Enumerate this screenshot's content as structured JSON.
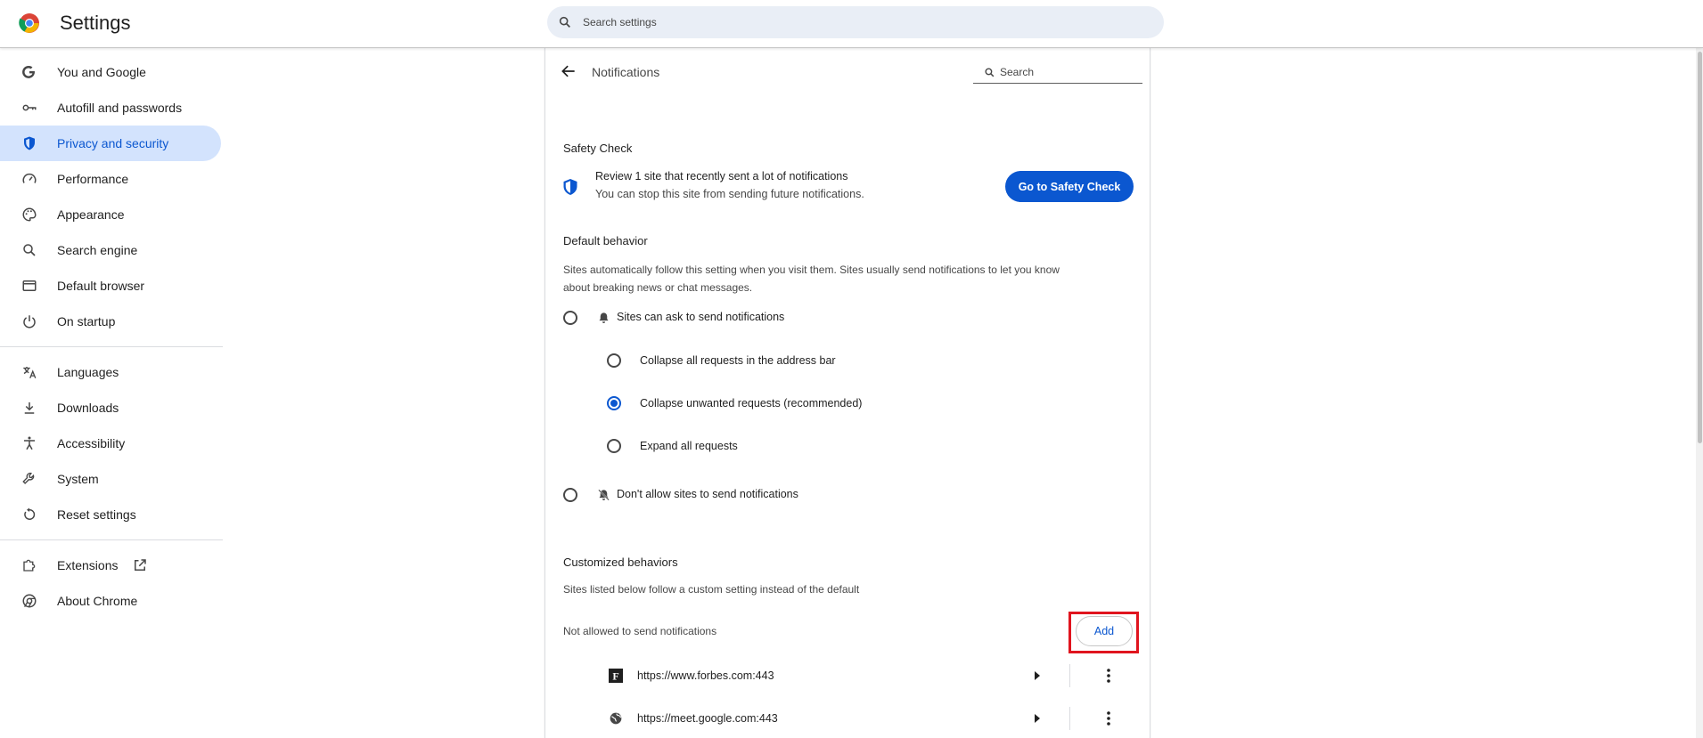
{
  "app": {
    "title": "Settings",
    "search_placeholder": "Search settings"
  },
  "colors": {
    "accent": "#0b57d0",
    "active_nav_bg": "#d3e3fd",
    "search_bg": "#e9eef6",
    "highlight": "#e0141e"
  },
  "sidebar": {
    "items": [
      {
        "label": "You and Google",
        "icon": "google-g-icon"
      },
      {
        "label": "Autofill and passwords",
        "icon": "key-icon"
      },
      {
        "label": "Privacy and security",
        "icon": "shield-icon",
        "active": true
      },
      {
        "label": "Performance",
        "icon": "speedometer-icon"
      },
      {
        "label": "Appearance",
        "icon": "palette-icon"
      },
      {
        "label": "Search engine",
        "icon": "search-icon"
      },
      {
        "label": "Default browser",
        "icon": "browser-window-icon"
      },
      {
        "label": "On startup",
        "icon": "power-icon"
      },
      {
        "label": "Languages",
        "icon": "translate-icon"
      },
      {
        "label": "Downloads",
        "icon": "download-icon"
      },
      {
        "label": "Accessibility",
        "icon": "accessibility-icon"
      },
      {
        "label": "System",
        "icon": "wrench-icon"
      },
      {
        "label": "Reset settings",
        "icon": "reset-icon"
      },
      {
        "label": "Extensions",
        "icon": "puzzle-icon"
      },
      {
        "label": "About Chrome",
        "icon": "chrome-icon"
      }
    ]
  },
  "page": {
    "title": "Notifications",
    "search_placeholder": "Search",
    "safety_check": {
      "heading": "Safety Check",
      "title": "Review 1 site that recently sent a lot of notifications",
      "subtitle": "You can stop this site from sending future notifications.",
      "button": "Go to Safety Check"
    },
    "default_behavior": {
      "heading": "Default behavior",
      "description_line1": "Sites automatically follow this setting when you visit them. Sites usually send notifications to let you know",
      "description_line2": "about breaking news or chat messages.",
      "option_ask": "Sites can ask to send notifications",
      "sub_options": [
        {
          "label": "Collapse all requests in the address bar",
          "checked": false
        },
        {
          "label": "Collapse unwanted requests (recommended)",
          "checked": true
        },
        {
          "label": "Expand all requests",
          "checked": false
        }
      ],
      "option_block": "Don't allow sites to send notifications"
    },
    "customized": {
      "heading": "Customized behaviors",
      "description": "Sites listed below follow a custom setting instead of the default",
      "not_allowed_label": "Not allowed to send notifications",
      "add_button": "Add",
      "sites": [
        {
          "url": "https://www.forbes.com:443",
          "icon": "forbes-favicon"
        },
        {
          "url": "https://meet.google.com:443",
          "icon": "globe-icon"
        }
      ]
    }
  }
}
